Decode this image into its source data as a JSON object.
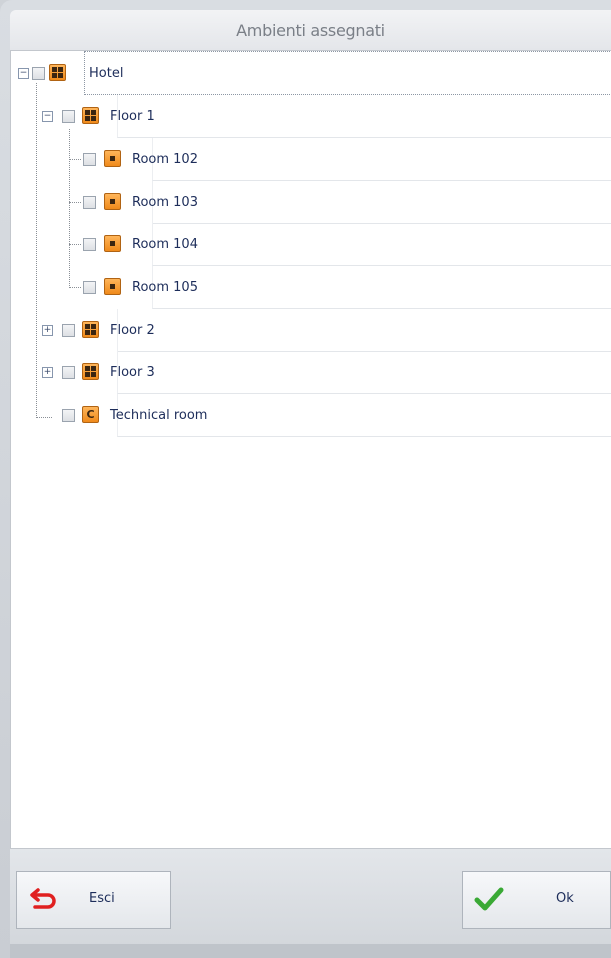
{
  "window": {
    "title": "Ambienti assegnati"
  },
  "tree": {
    "nodes": [
      {
        "label": "Hotel",
        "icon": "building-grid-icon",
        "expander": "−"
      },
      {
        "label": "Floor 1",
        "icon": "floor-grid-icon",
        "expander": "−"
      },
      {
        "label": "Room 102",
        "icon": "room-dot-icon"
      },
      {
        "label": "Room 103",
        "icon": "room-dot-icon"
      },
      {
        "label": "Room 104",
        "icon": "room-dot-icon"
      },
      {
        "label": "Room 105",
        "icon": "room-dot-icon"
      },
      {
        "label": "Floor 2",
        "icon": "floor-grid-icon",
        "expander": "+"
      },
      {
        "label": "Floor 3",
        "icon": "floor-grid-icon",
        "expander": "+"
      },
      {
        "label": "Technical room",
        "icon": "technical-room-icon",
        "glyph": "C"
      }
    ]
  },
  "buttons": {
    "exit_label": "Esci",
    "ok_label": "Ok"
  },
  "colors": {
    "node_icon_orange": "#f39a2c",
    "ok_check_green": "#3aa935",
    "exit_arrow_red": "#e02020",
    "label_text": "#1d2d5a"
  }
}
